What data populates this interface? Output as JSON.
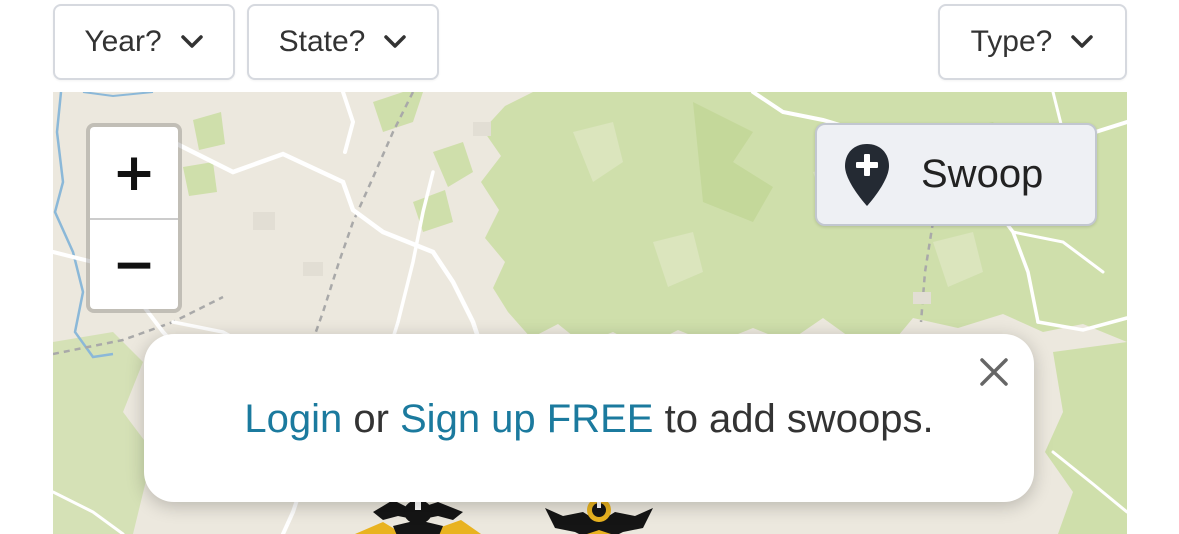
{
  "filters": [
    {
      "label": "Year?",
      "icon": "chevron-down-icon"
    },
    {
      "label": "State?",
      "icon": "chevron-down-icon"
    },
    {
      "label": "Type?",
      "icon": "chevron-down-icon"
    }
  ],
  "map": {
    "zoom_in_label": "+",
    "zoom_out_label": "−",
    "swoop_button": {
      "label": "Swoop",
      "icon": "add-location-pin-icon"
    },
    "colors": {
      "land": "#ece8de",
      "forest": "#cfdfab",
      "road": "#ffffff",
      "water": "#8bb8d8",
      "boundary": "#a9a9a9",
      "emblem_gold": "#e9b320",
      "emblem_black": "#151515"
    }
  },
  "popup": {
    "login_link": "Login",
    "or_text": " or ",
    "signup_link": "Sign up FREE",
    "suffix_text": " to add swoops.",
    "close_icon": "close-icon"
  }
}
